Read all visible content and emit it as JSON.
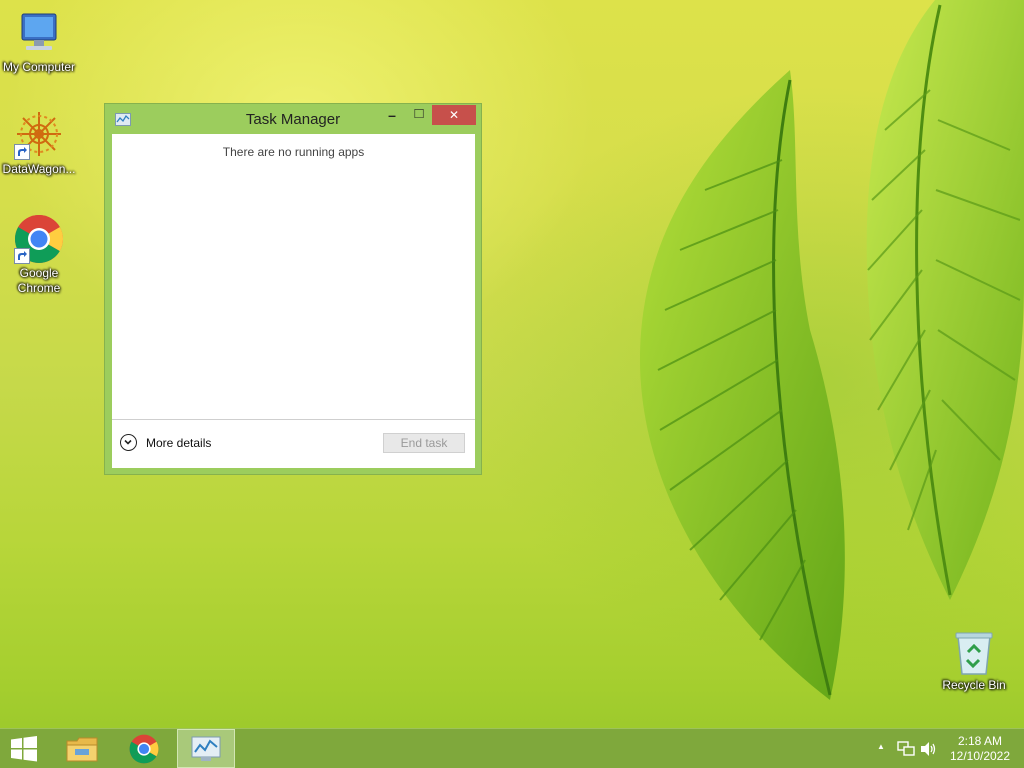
{
  "desktop": {
    "icons": [
      {
        "label": "My Computer"
      },
      {
        "label": "DataWagon..."
      },
      {
        "label": "Google Chrome"
      },
      {
        "label": "Recycle Bin"
      }
    ]
  },
  "window": {
    "title": "Task Manager",
    "empty_message": "There are no running apps",
    "more_details_label": "More details",
    "end_task_label": "End task",
    "controls": {
      "minimize": "–",
      "maximize": "□",
      "close": "✕"
    }
  },
  "taskbar": {
    "items": [
      {
        "icon": "windows-start-icon"
      },
      {
        "icon": "file-explorer-icon"
      },
      {
        "icon": "chrome-icon"
      },
      {
        "icon": "task-manager-icon",
        "active": true
      }
    ],
    "tray": {
      "show_hidden_glyph": "▲",
      "time": "2:18 AM",
      "date": "12/10/2022"
    }
  },
  "colors": {
    "window_frame": "#9ccd5d",
    "close_button": "#c7504b",
    "taskbar": "#7fa83c"
  }
}
